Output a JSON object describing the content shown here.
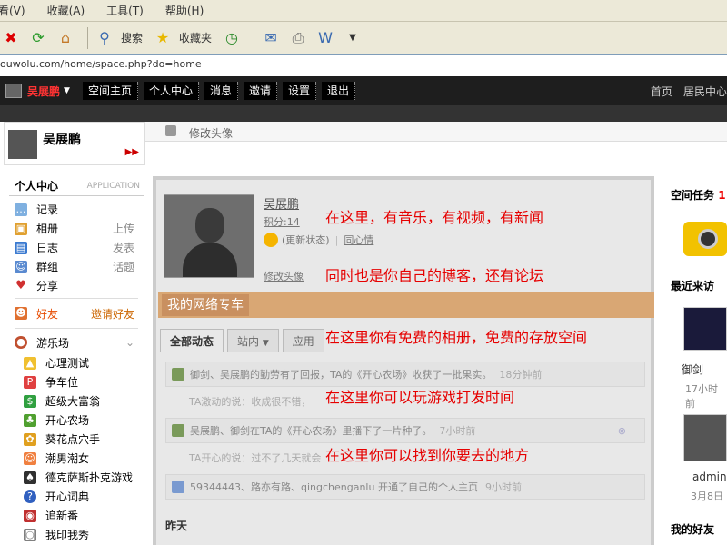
{
  "browser": {
    "menu": [
      "看(V)",
      "收藏(A)",
      "工具(T)",
      "帮助(H)"
    ],
    "toolbar": {
      "search_label": "搜索",
      "favorites_label": "收藏夹"
    },
    "address": "ouwolu.com/home/space.php?do=home"
  },
  "site_nav": {
    "username": "吴展鹏",
    "items": [
      "空间主页",
      "个人中心",
      "消息",
      "邀请",
      "设置",
      "退出"
    ],
    "right_links": [
      "首页",
      "居民中心"
    ]
  },
  "profile": {
    "name": "吴展鹏",
    "edit_avatar_label": "修改头像"
  },
  "sidebar": {
    "title": "个人中心",
    "subtitle": "APPLICATION",
    "items": [
      {
        "label": "记录",
        "action": ""
      },
      {
        "label": "相册",
        "action": "上传"
      },
      {
        "label": "日志",
        "action": "发表"
      },
      {
        "label": "群组",
        "action": "话题"
      },
      {
        "label": "分享",
        "action": ""
      }
    ],
    "friends_label": "好友",
    "invite_label": "邀请好友",
    "games_label": "游乐场",
    "games": [
      "心理测试",
      "争车位",
      "超级大富翁",
      "开心农场",
      "葵花点穴手",
      "潮男潮女",
      "德克萨斯扑克游戏",
      "开心词典",
      "追新番",
      "我印我秀"
    ]
  },
  "main": {
    "name": "吴展鹏",
    "score": "积分:14",
    "status_link": "更新状态",
    "mood_link": "同心情",
    "edit_avatar_link": "修改头像",
    "banner": "我的网络专车",
    "tabs": [
      "全部动态",
      "站内",
      "应用"
    ],
    "feed": [
      {
        "text": "御剑、吴展鹏的勤劳有了回报，TA的《开心农场》收获了一批果实。",
        "time": "18分钟前",
        "sub": "TA激动的说：收成很不错，"
      },
      {
        "text": "吴展鹏、御剑在TA的《开心农场》里播下了一片种子。",
        "time": "7小时前",
        "sub": "TA开心的说：过不了几天就会"
      },
      {
        "text": "59344443、路亦有路、qingchenganlu 开通了自己的个人主页",
        "time": "9小时前",
        "sub": ""
      }
    ],
    "yesterday_label": "昨天"
  },
  "overlay_lines": [
    "在这里，有音乐，有视频，有新闻",
    "同时也是你自己的博客，还有论坛",
    "在这里你有免费的相册，免费的存放空间",
    "在这里你可以玩游戏打发时间",
    "在这里你可以找到你要去的地方"
  ],
  "rightbar": {
    "task_title": "空间任务",
    "task_count": "1",
    "visitors_title": "最近来访",
    "visitors": [
      {
        "name": "御剑",
        "time": "17小时前"
      },
      {
        "name": "admin",
        "time": "3月8日"
      }
    ],
    "friends_title": "我的好友"
  }
}
